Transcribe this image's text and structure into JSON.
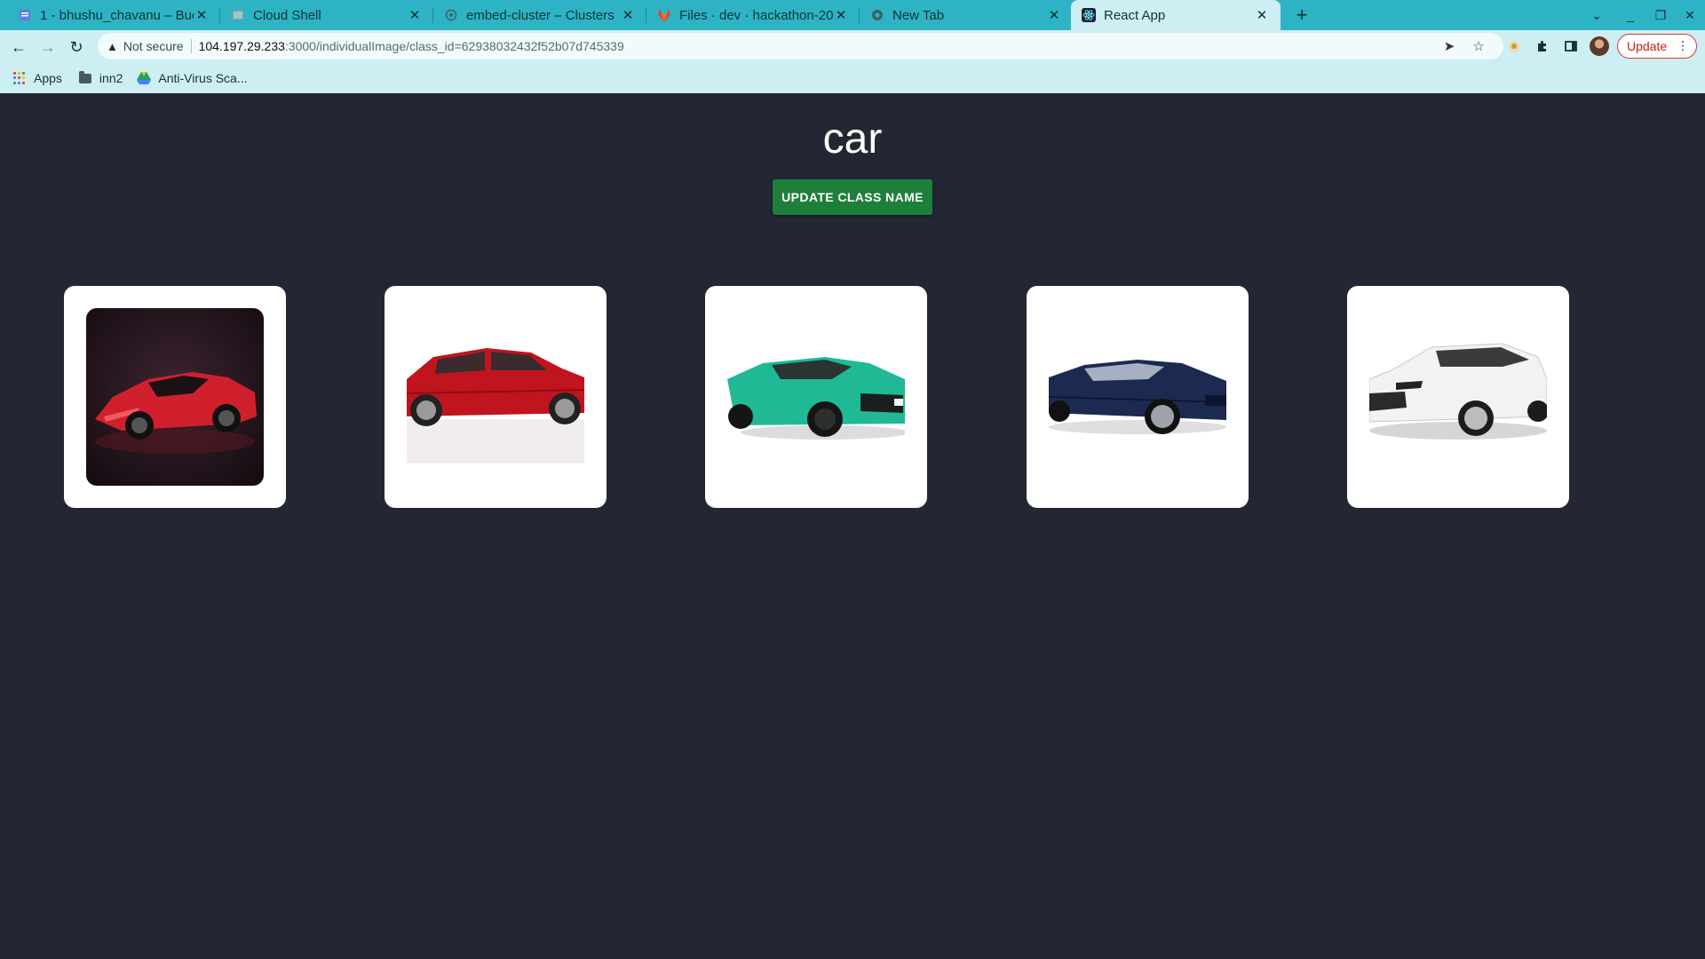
{
  "browser": {
    "tabs": [
      {
        "title": "1 - bhushu_chavanu – Buc",
        "icon": "doc-icon"
      },
      {
        "title": "Cloud Shell",
        "icon": "cloud-shell-icon"
      },
      {
        "title": "embed-cluster – Clusters",
        "icon": "cluster-icon"
      },
      {
        "title": "Files · dev · hackathon-20",
        "icon": "gitlab-icon"
      },
      {
        "title": "New Tab",
        "icon": "chrome-icon"
      },
      {
        "title": "React App",
        "icon": "react-icon",
        "active": true
      }
    ],
    "address": {
      "security": "Not secure",
      "host": "104.197.29.233",
      "rest": ":3000/individualImage/class_id=62938032432f52b07d745339"
    },
    "update_label": "Update",
    "bookmarks": [
      {
        "label": "Apps",
        "icon": "apps-grid-icon"
      },
      {
        "label": "inn2",
        "icon": "folder-icon"
      },
      {
        "label": "Anti-Virus Sca...",
        "icon": "drive-icon"
      }
    ]
  },
  "page": {
    "class_name": "car",
    "update_button": "UPDATE CLASS NAME",
    "images": [
      {
        "name": "red-sports-car",
        "body": "#d0202e",
        "bg": "dark"
      },
      {
        "name": "red-hatchback",
        "body": "#c0141e",
        "bg": "white"
      },
      {
        "name": "teal-coupe",
        "body": "#1fb996",
        "bg": "white"
      },
      {
        "name": "navy-sedan",
        "body": "#1c2a52",
        "bg": "white"
      },
      {
        "name": "white-suv",
        "body": "#f2f2f2",
        "bg": "white"
      }
    ]
  }
}
